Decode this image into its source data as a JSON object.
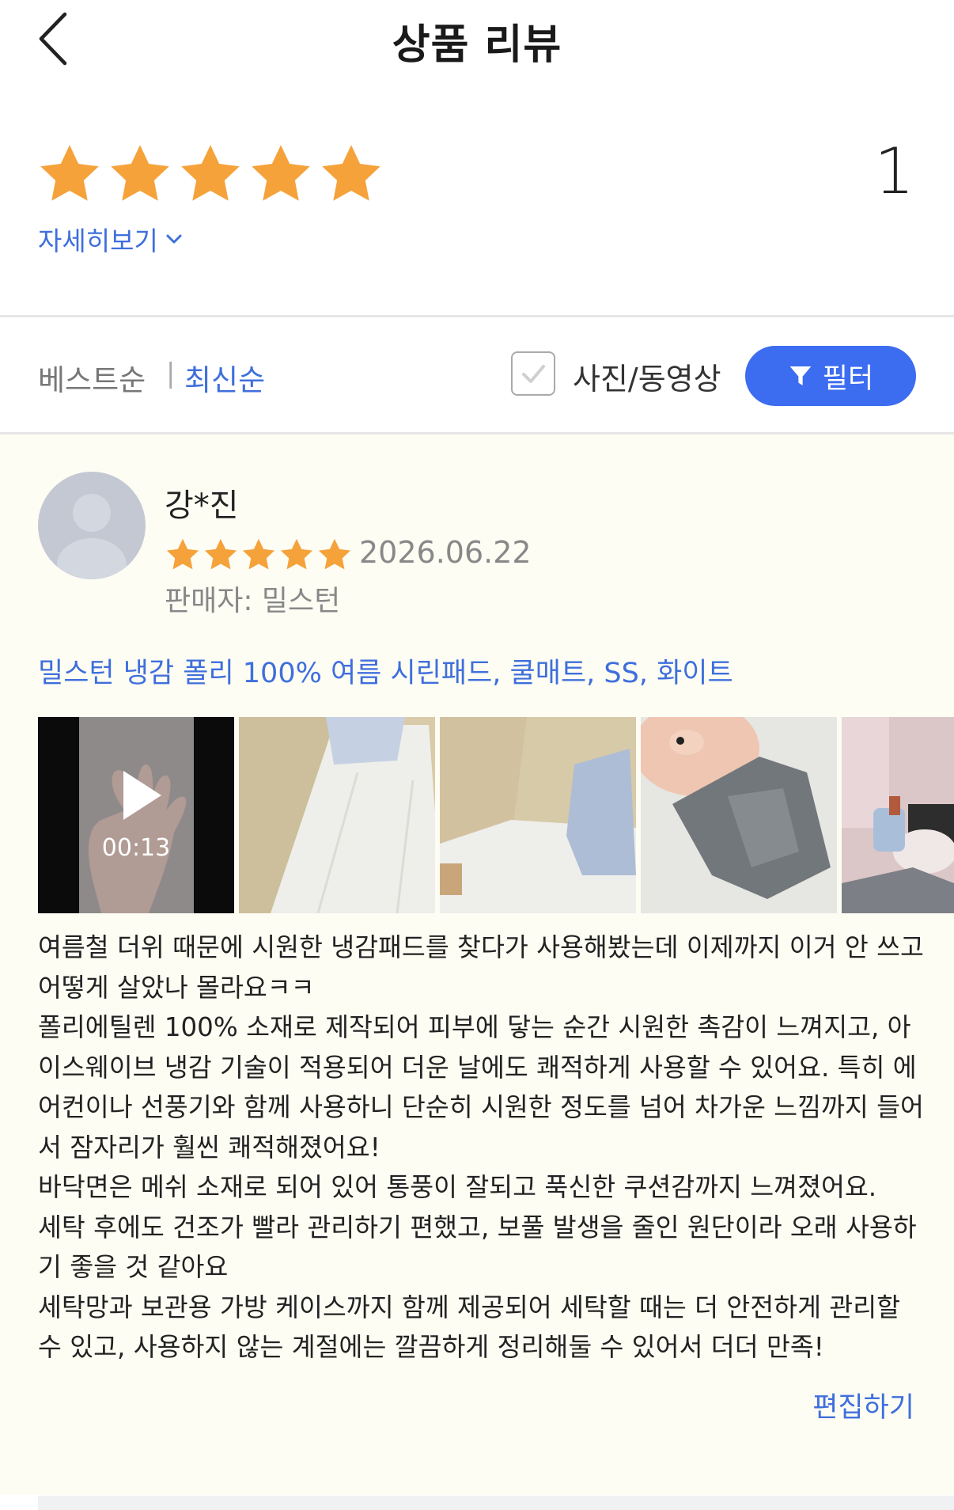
{
  "header": {
    "title": "상품 리뷰",
    "back_icon": "chevron-left-icon"
  },
  "summary": {
    "rating": 5,
    "max_rating": 5,
    "star_color": "#f5a23a",
    "review_count": "1",
    "detail_label": "자세히보기"
  },
  "sort": {
    "options": [
      "베스트순",
      "최신순"
    ],
    "selected": "최신순",
    "separator": "|"
  },
  "photo_filter": {
    "label": "사진/동영상",
    "checked": false
  },
  "filter_button": {
    "label": "필터",
    "color": "#3c6cf0"
  },
  "review": {
    "reviewer": "강*진",
    "rating": 5,
    "date": "2026.06.22",
    "seller": "판매자: 밀스턴",
    "product": "밀스턴 냉감 폴리 100% 여름 시린패드, 쿨매트, SS, 화이트",
    "media": {
      "video_duration": "00:13",
      "photo_count": 4
    },
    "text": "여름철 더위 때문에 시원한 냉감패드를 찾다가 사용해봤는데 이제까지 이거 안 쓰고 어떻게 살았나 몰라요ㅋㅋ\n폴리에틸렌 100% 소재로 제작되어 피부에 닿는 순간 시원한 촉감이 느껴지고, 아이스웨이브 냉감 기술이 적용되어 더운 날에도 쾌적하게 사용할 수 있어요. 특히 에어컨이나 선풍기와 함께 사용하니 단순히 시원한 정도를 넘어 차가운 느낌까지 들어서 잠자리가 훨씬 쾌적해졌어요!\n바닥면은 메쉬 소재로 되어 있어 통풍이 잘되고 푹신한 쿠션감까지 느껴졌어요.\n세탁 후에도 건조가 빨라 관리하기 편했고, 보풀 발생을 줄인 원단이라 오래 사용하기 좋을 것 같아요\n세탁망과 보관용 가방 케이스까지 함께 제공되어 세탁할 때는 더 안전하게 관리할 수 있고, 사용하지 않는 계절에는 깔끔하게 정리해둘 수 있어서 더더 만족!",
    "edit_label": "편집하기"
  },
  "colors": {
    "accent_blue": "#3f6fdc",
    "card_background": "#fdfdf4"
  }
}
